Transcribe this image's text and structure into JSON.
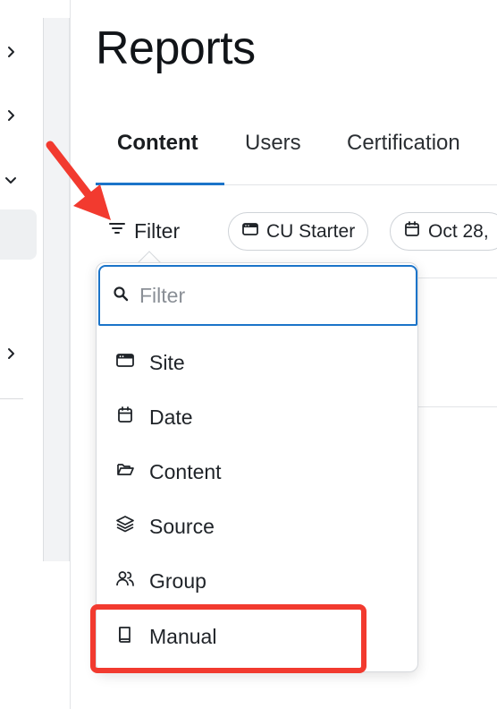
{
  "page": {
    "title": "Reports"
  },
  "tabs": [
    {
      "label": "Content",
      "active": true
    },
    {
      "label": "Users",
      "active": false
    },
    {
      "label": "Certification",
      "active": false
    }
  ],
  "filter_bar": {
    "filter_label": "Filter",
    "chips": [
      {
        "icon": "site-icon",
        "label": "CU Starter"
      },
      {
        "icon": "calendar-icon",
        "label": "Oct 28,"
      }
    ]
  },
  "dropdown": {
    "search_placeholder": "Filter",
    "items": [
      {
        "icon": "site-icon",
        "label": "Site"
      },
      {
        "icon": "calendar-icon",
        "label": "Date"
      },
      {
        "icon": "folder-icon",
        "label": "Content"
      },
      {
        "icon": "layers-icon",
        "label": "Source"
      },
      {
        "icon": "group-icon",
        "label": "Group"
      },
      {
        "icon": "book-icon",
        "label": "Manual",
        "highlighted": true
      }
    ]
  },
  "colors": {
    "accent": "#1b74c9",
    "annotation": "#f23a2f",
    "active_tab_underline": "#1b74c9"
  }
}
